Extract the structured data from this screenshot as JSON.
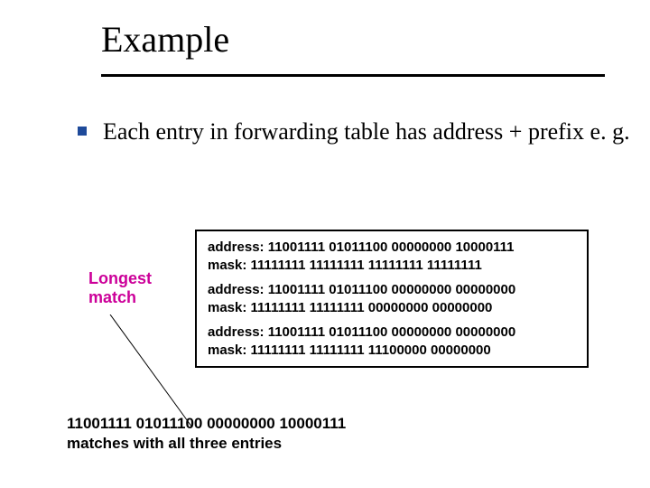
{
  "title": "Example",
  "bullet": "Each entry in forwarding table has address + prefix e. g.",
  "label": {
    "line1": "Longest",
    "line2": "match"
  },
  "entries": [
    {
      "address": "address: 11001111 01011100 00000000 10000111",
      "mask": "mask:      11111111 11111111 11111111 11111111"
    },
    {
      "address": "address: 11001111 01011100 00000000 00000000",
      "mask": "mask:      11111111 11111111 00000000 00000000"
    },
    {
      "address": "address: 11001111 01011100 00000000 00000000",
      "mask": "mask:      11111111 11111111 11100000 00000000"
    }
  ],
  "bottom": {
    "l1": "11001111 01011100 00000000 10000111",
    "l2": "matches with all three entries"
  }
}
